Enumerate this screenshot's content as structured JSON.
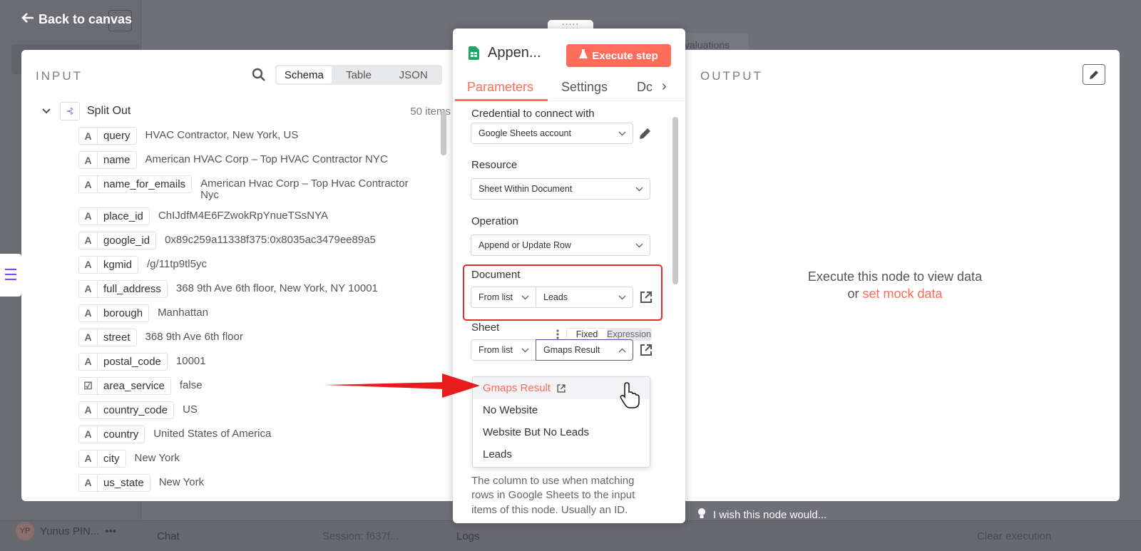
{
  "background": {
    "back_label": "Back to canvas",
    "evaluations_tab": "valuations",
    "user_name": "Yunus PIN...",
    "user_initials": "YP",
    "chat_label": "Chat",
    "session_label": "Session: f637f...",
    "logs_label": "Logs",
    "clear_label": "Clear execution",
    "wish_label": "I wish this node would..."
  },
  "input": {
    "title": "INPUT",
    "tabs": [
      "Schema",
      "Table",
      "JSON"
    ],
    "active_tab": "Schema",
    "node_name": "Split Out",
    "items_count": "50 items",
    "fields": [
      {
        "type": "A",
        "name": "query",
        "value": "HVAC Contractor, New York, US"
      },
      {
        "type": "A",
        "name": "name",
        "value": "American HVAC Corp – Top HVAC Contractor NYC"
      },
      {
        "type": "A",
        "name": "name_for_emails",
        "value": "American Hvac Corp – Top Hvac Contractor Nyc"
      },
      {
        "type": "A",
        "name": "place_id",
        "value": "ChIJdfM4E6FZwokRpYnueTSsNYA"
      },
      {
        "type": "A",
        "name": "google_id",
        "value": "0x89c259a11338f375:0x8035ac3479ee89a5"
      },
      {
        "type": "A",
        "name": "kgmid",
        "value": "/g/11tp9tl5yc"
      },
      {
        "type": "A",
        "name": "full_address",
        "value": "368 9th Ave 6th floor, New York, NY 10001"
      },
      {
        "type": "A",
        "name": "borough",
        "value": "Manhattan"
      },
      {
        "type": "A",
        "name": "street",
        "value": "368 9th Ave 6th floor"
      },
      {
        "type": "A",
        "name": "postal_code",
        "value": "10001"
      },
      {
        "type": "☑",
        "name": "area_service",
        "value": "false"
      },
      {
        "type": "A",
        "name": "country_code",
        "value": "US"
      },
      {
        "type": "A",
        "name": "country",
        "value": "United States of America"
      },
      {
        "type": "A",
        "name": "city",
        "value": "New York"
      },
      {
        "type": "A",
        "name": "us_state",
        "value": "New York"
      }
    ]
  },
  "node": {
    "title": "Appen...",
    "execute_label": "Execute step",
    "tabs": [
      "Parameters",
      "Settings",
      "Dc"
    ],
    "active_tab": "Parameters",
    "credential_label": "Credential to connect with",
    "credential_value": "Google Sheets account",
    "resource_label": "Resource",
    "resource_value": "Sheet Within Document",
    "operation_label": "Operation",
    "operation_value": "Append or Update Row",
    "document_label": "Document",
    "document_mode": "From list",
    "document_value": "Leads",
    "sheet_label": "Sheet",
    "sheet_toggle": [
      "Fixed",
      "Expression"
    ],
    "sheet_mode": "From list",
    "sheet_value": "Gmaps Result",
    "sheet_options": [
      "Gmaps Result",
      "No Website",
      "Website But No Leads",
      "Leads"
    ],
    "description": "The column to use when matching rows in Google Sheets to the input items of this node. Usually an ID."
  },
  "output": {
    "title": "OUTPUT",
    "message": "Execute this node to view data",
    "or_text": "or",
    "mock_link": "set mock data"
  },
  "colors": {
    "accent": "#ff6d5a",
    "highlight": "#e32c2c",
    "focus": "#5a52a0"
  }
}
